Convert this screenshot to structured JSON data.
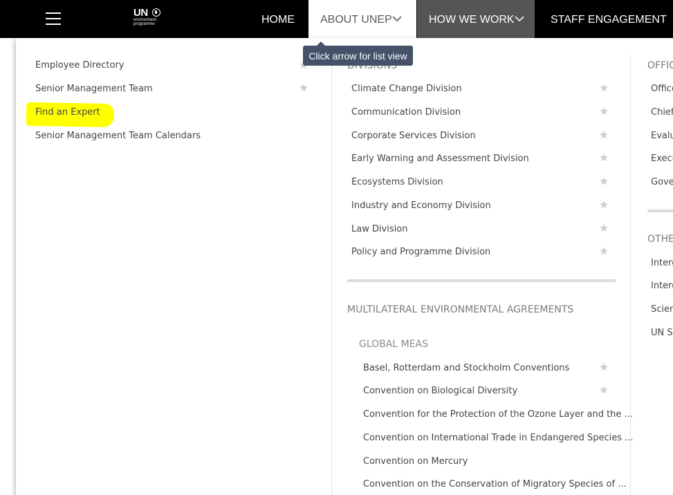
{
  "header": {
    "logo_text": "UN",
    "logo_subtitle_line1": "environment",
    "logo_subtitle_line2": "programme",
    "nav": {
      "home": "HOME",
      "about": "ABOUT UNEP",
      "how": "HOW WE WORK",
      "staff": "STAFF ENGAGEMENT"
    }
  },
  "tooltip": "Click arrow for list view",
  "menu": {
    "col1": {
      "items": [
        "Employee Directory",
        "Senior Management Team",
        "Find an Expert",
        "Senior Management Team Calendars"
      ]
    },
    "col2": {
      "divisions_heading": "DIVISIONS",
      "divisions": [
        "Climate Change Division",
        "Communication Division",
        "Corporate Services Division",
        "Early Warning and Assessment Division",
        "Ecosystems Division",
        "Industry and Economy Division",
        "Law Division",
        "Policy and Programme Division"
      ],
      "mea_heading": "MULTILATERAL ENVIRONMENTAL AGREEMENTS",
      "global_heading": "GLOBAL MEAS",
      "global_meas": [
        "Basel, Rotterdam and Stockholm Conventions",
        "Convention on Biological Diversity",
        "Convention for the Protection of the Ozone Layer and the ...",
        "Convention on International Trade in Endangered Species ...",
        "Convention on Mercury",
        "Convention on the Conservation of Migratory Species of ..."
      ]
    },
    "col3": {
      "offices_heading": "OFFIC",
      "offices": [
        "Office",
        "Chief",
        "Evalu",
        "Execu",
        "Gove"
      ],
      "other_heading": "OTHEI",
      "other": [
        "Interg",
        "Interg",
        "Scien",
        "UN S"
      ]
    }
  }
}
